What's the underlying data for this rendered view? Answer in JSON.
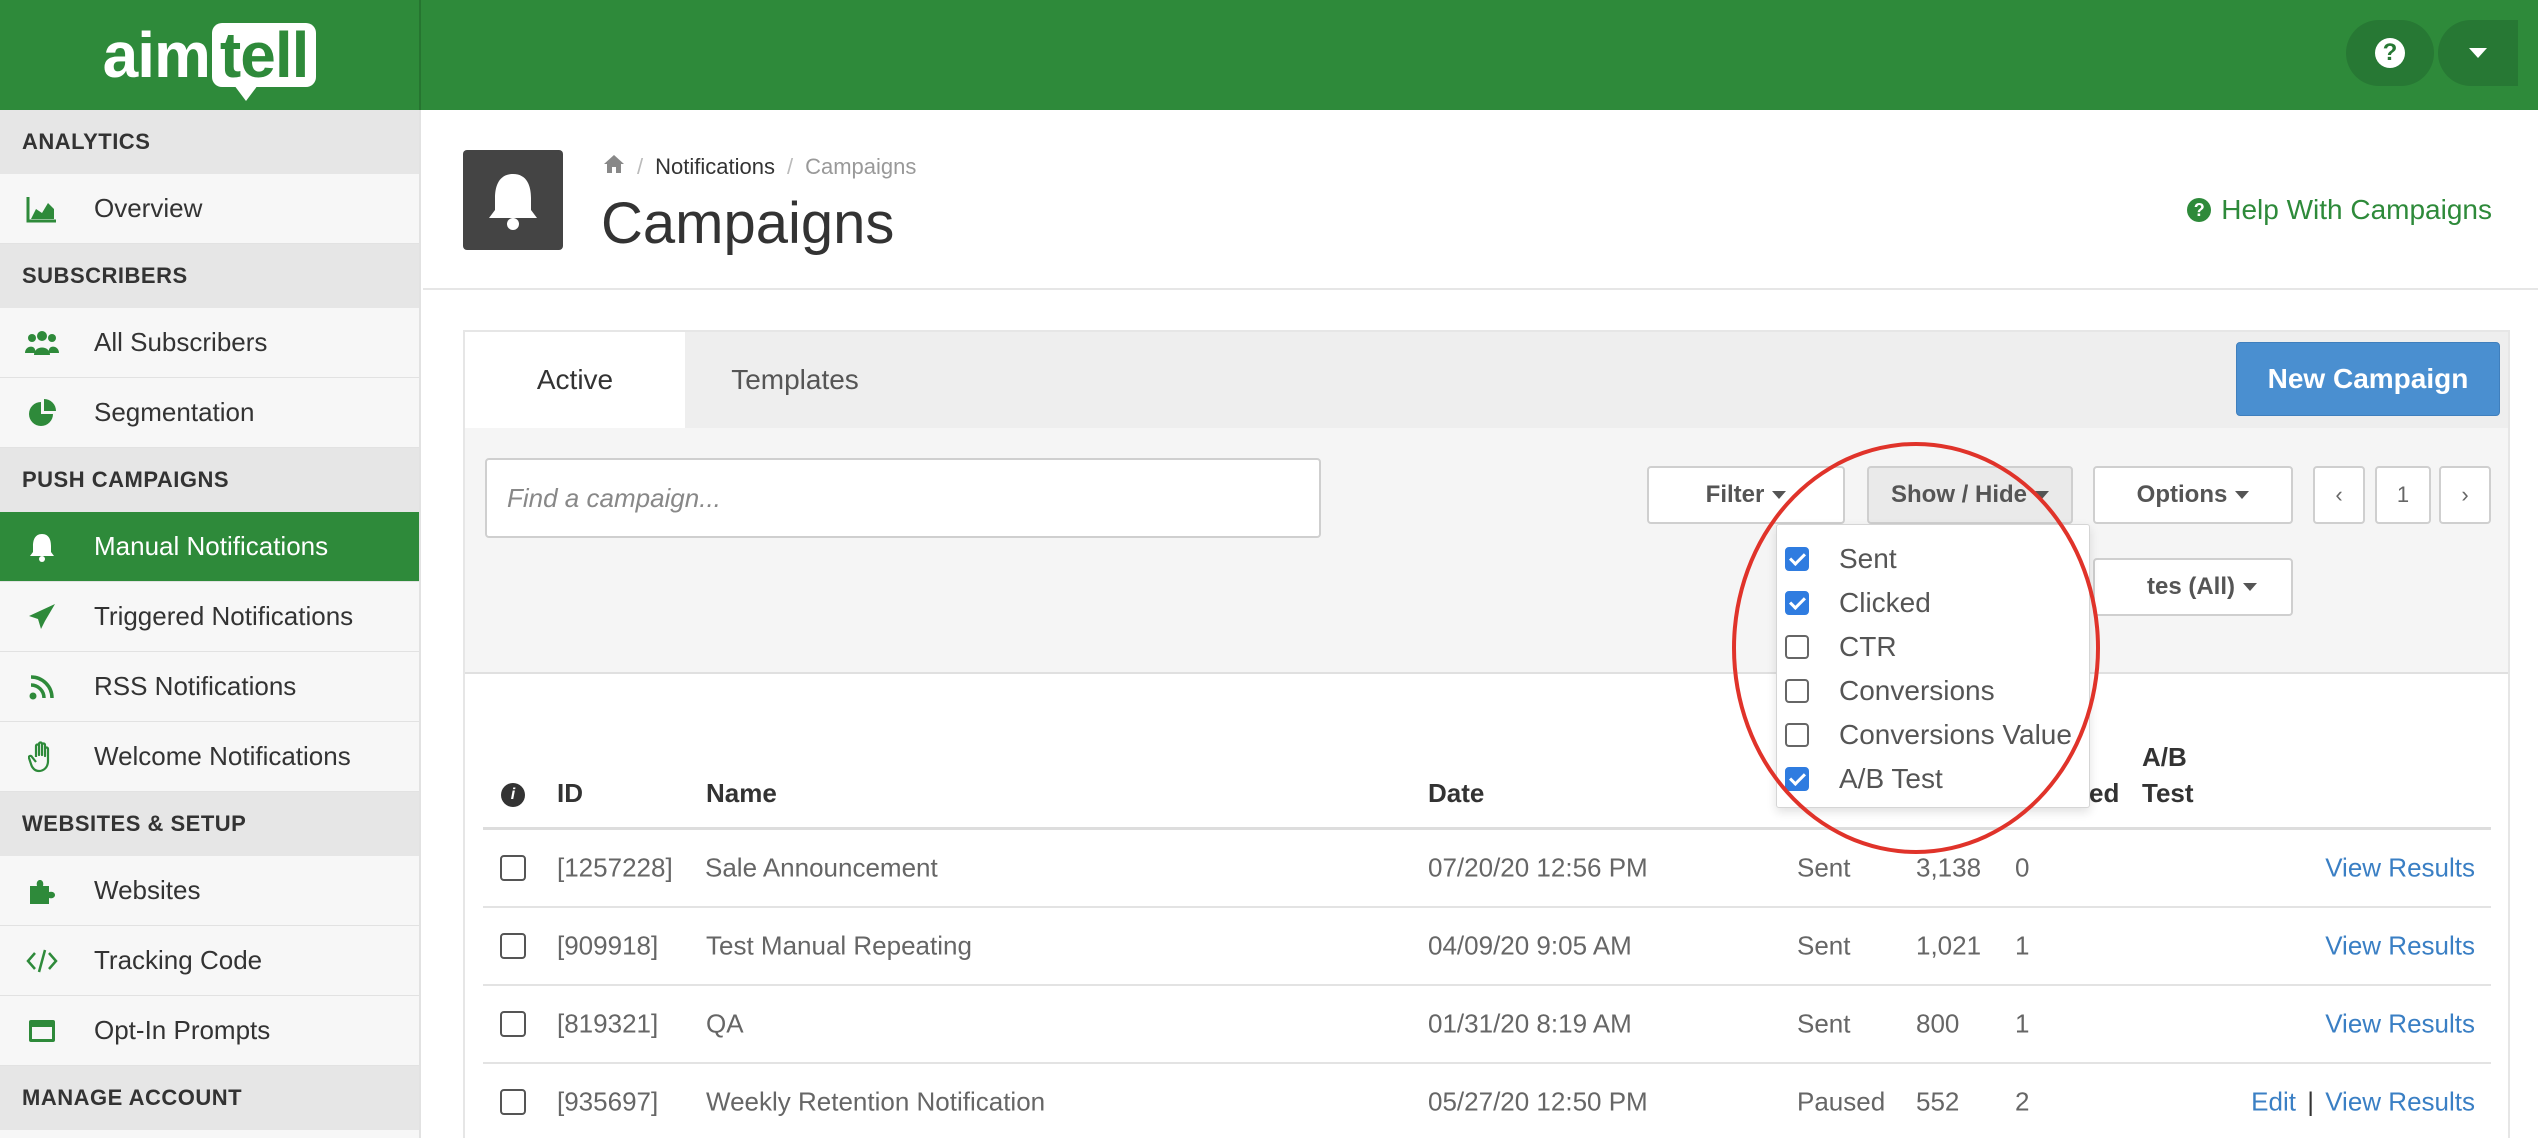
{
  "brand": {
    "logo_left": "aim",
    "logo_right": "tell",
    "color": "#2e8a3a"
  },
  "topbar": {
    "help_icon": "question-circle-icon",
    "menu_icon": "caret-down-icon",
    "help_glyph": "?"
  },
  "sidebar": {
    "sections": [
      {
        "title": "ANALYTICS",
        "items": [
          {
            "label": "Overview",
            "icon": "area-chart-icon"
          }
        ]
      },
      {
        "title": "SUBSCRIBERS",
        "items": [
          {
            "label": "All Subscribers",
            "icon": "users-icon"
          },
          {
            "label": "Segmentation",
            "icon": "pie-chart-icon"
          }
        ]
      },
      {
        "title": "PUSH CAMPAIGNS",
        "items": [
          {
            "label": "Manual Notifications",
            "icon": "bell-icon",
            "active": true
          },
          {
            "label": "Triggered Notifications",
            "icon": "paper-plane-icon"
          },
          {
            "label": "RSS Notifications",
            "icon": "rss-icon"
          },
          {
            "label": "Welcome Notifications",
            "icon": "wave-hand-icon"
          }
        ]
      },
      {
        "title": "WEBSITES & SETUP",
        "items": [
          {
            "label": "Websites",
            "icon": "puzzle-icon"
          },
          {
            "label": "Tracking Code",
            "icon": "code-icon"
          },
          {
            "label": "Opt-In Prompts",
            "icon": "window-icon"
          }
        ]
      },
      {
        "title": "MANAGE ACCOUNT",
        "items": []
      }
    ]
  },
  "header": {
    "breadcrumb": {
      "home_icon": "home-icon",
      "separator": "/",
      "link": "Notifications",
      "current": "Campaigns"
    },
    "title": "Campaigns",
    "help_link": "Help With Campaigns",
    "help_glyph": "?"
  },
  "tabs": [
    {
      "label": "Active",
      "active": true
    },
    {
      "label": "Templates",
      "active": false
    }
  ],
  "new_campaign_label": "New Campaign",
  "toolbar": {
    "search_placeholder": "Find a campaign...",
    "filter_label": "Filter",
    "show_hide_label": "Show / Hide",
    "options_label": "Options",
    "websites_label_partial": "tes (All)",
    "pagination": {
      "prev": "‹",
      "page": "1",
      "next": "›"
    }
  },
  "show_hide_menu": [
    {
      "label": "Sent",
      "checked": true
    },
    {
      "label": "Clicked",
      "checked": true
    },
    {
      "label": "CTR",
      "checked": false
    },
    {
      "label": "Conversions",
      "checked": false
    },
    {
      "label": "Conversions Value",
      "checked": false
    },
    {
      "label": "A/B Test",
      "checked": true
    }
  ],
  "table": {
    "headers": {
      "info": "i",
      "id": "ID",
      "name": "Name",
      "date": "Date",
      "clicked_partial": "ed",
      "ab_line1": "A/B",
      "ab_line2": "Test"
    },
    "rows": [
      {
        "id": "[1257228]",
        "name": "Sale Announcement",
        "date": "07/20/20 12:56 PM",
        "status": "Sent",
        "sent": "3,138",
        "clicked": "0",
        "actions": [
          "View Results"
        ]
      },
      {
        "id": "[909918]",
        "name": "Test Manual Repeating",
        "date": "04/09/20 9:05 AM",
        "status": "Sent",
        "sent": "1,021",
        "clicked": "1",
        "actions": [
          "View Results"
        ]
      },
      {
        "id": "[819321]",
        "name": "QA",
        "date": "01/31/20 8:19 AM",
        "status": "Sent",
        "sent": "800",
        "clicked": "1",
        "actions": [
          "View Results"
        ]
      },
      {
        "id": "[935697]",
        "name": "Weekly Retention Notification",
        "date": "05/27/20 12:50 PM",
        "status": "Paused",
        "sent": "552",
        "clicked": "2",
        "actions": [
          "Edit",
          "View Results"
        ]
      }
    ],
    "action_separator": "|"
  },
  "colors": {
    "green": "#2e8a3a",
    "blue_button": "#4a8fd0",
    "link": "#3a7fc4",
    "highlight_circle": "#e0332a",
    "checkbox_on": "#2f7ce0"
  }
}
